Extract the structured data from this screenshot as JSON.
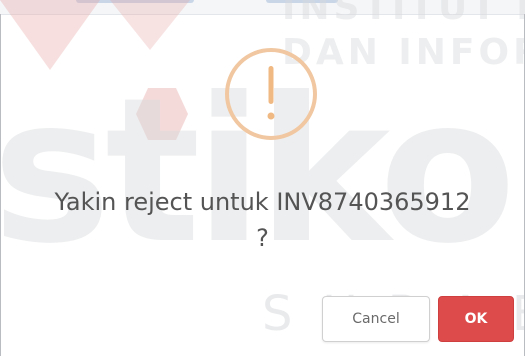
{
  "watermark": {
    "large": "stikom",
    "top_line1": "INSTITUT BISNIS",
    "top_line2": "DAN INFORMATIKA",
    "bottom": "SURABAYA"
  },
  "dialog": {
    "message_line1": "Yakin reject untuk INV8740365912",
    "message_line2": "?",
    "cancel_label": "Cancel",
    "ok_label": "OK"
  },
  "colors": {
    "warning_icon": "#f0c7a0",
    "ok_button": "#dd4b4b",
    "message_text": "#545454"
  },
  "icons": {
    "warning": "exclamation-circle-icon"
  }
}
